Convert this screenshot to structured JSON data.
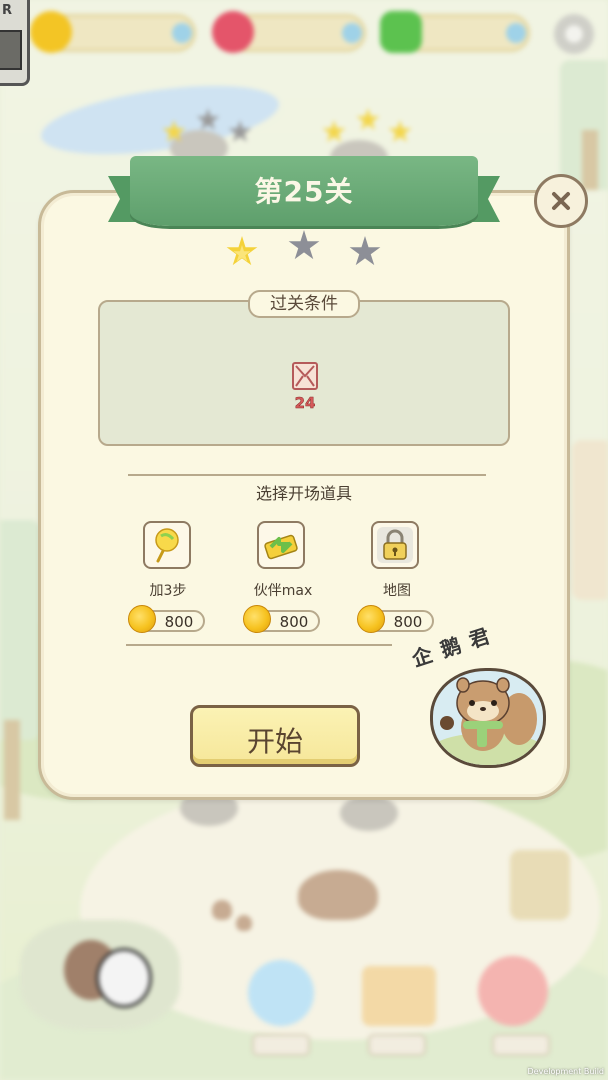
{
  "level": {
    "title": "第25关",
    "stars_earned": 1,
    "stars_total": 3
  },
  "conditions": {
    "title": "过关条件",
    "goal_count": "24"
  },
  "boosters": {
    "label": "选择开场道具",
    "items": [
      {
        "name": "加3步",
        "price": "800",
        "icon": "lollipop-icon"
      },
      {
        "name": "伙伴max",
        "price": "800",
        "icon": "swap-arrows-icon"
      },
      {
        "name": "地图",
        "price": "800",
        "icon": "lock-icon"
      }
    ]
  },
  "start_label": "开始",
  "mascot_label": "企鹅君",
  "footer": {
    "dev_build": "Development Build"
  },
  "colors": {
    "ribbon": "#5e9f6c",
    "panel": "#fbf8e2",
    "star_on": "#f4d23a",
    "star_off": "#8d8f97",
    "start_button": "#f6e79a"
  }
}
